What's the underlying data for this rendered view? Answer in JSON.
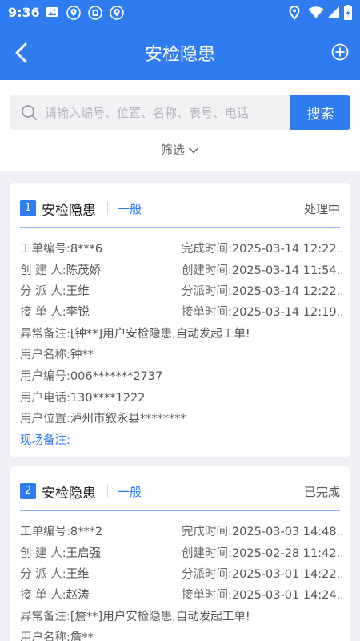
{
  "statusbar": {
    "time": "9:36"
  },
  "header": {
    "title": "安检隐患"
  },
  "search": {
    "placeholder": "请输入编号、位置、名称、表号、电话",
    "button": "搜索"
  },
  "filter": {
    "label": "筛选"
  },
  "cards": [
    {
      "index": "1",
      "title": "安检隐患",
      "level": "一般",
      "status": "处理中",
      "order_no_label": "工单编号:",
      "order_no": "8***6",
      "done_time_label": "完成时间:",
      "done_time": "2025-03-14 12:22...",
      "creator_label": "创 建 人:",
      "creator": "陈茂娇",
      "create_time_label": "创建时间:",
      "create_time": "2025-03-14 11:54...",
      "dispatcher_label": "分 派 人:",
      "dispatcher": "王维",
      "dispatch_time_label": "分派时间:",
      "dispatch_time": "2025-03-14 12:22...",
      "receiver_label": "接 单 人:",
      "receiver": "李锐",
      "receive_time_label": "接单时间:",
      "receive_time": "2025-03-14 12:19...",
      "remark_label": "异常备注:",
      "remark": "[钟**]用户安检隐患,自动发起工单!",
      "user_name_label": "用户名称:",
      "user_name": "钟**",
      "user_no_label": "用户编号:",
      "user_no": "006*******2737",
      "user_phone_label": "用户电话:",
      "user_phone": "130****1222",
      "user_location_label": "用户位置:",
      "user_location": "泸州市叙永县********",
      "site_remark_label": "现场备注:"
    },
    {
      "index": "2",
      "title": "安检隐患",
      "level": "一般",
      "status": "已完成",
      "order_no_label": "工单编号:",
      "order_no": "8***2",
      "done_time_label": "完成时间:",
      "done_time": "2025-03-03 14:48...",
      "creator_label": "创 建 人:",
      "creator": "王启强",
      "create_time_label": "创建时间:",
      "create_time": "2025-02-28 11:42...",
      "dispatcher_label": "分 派 人:",
      "dispatcher": "王维",
      "dispatch_time_label": "分派时间:",
      "dispatch_time": "2025-03-01 14:22...",
      "receiver_label": "接 单 人:",
      "receiver": "赵涛",
      "receive_time_label": "接单时间:",
      "receive_time": "2025-03-01 14:24...",
      "remark_label": "异常备注:",
      "remark": "[詹**]用户安检隐患,自动发起工单!",
      "user_name_label": "用户名称:",
      "user_name": "詹**"
    }
  ],
  "colors": {
    "primary": "#2f7bf0",
    "background": "#eef0f3"
  },
  "icons": [
    "image-icon",
    "location-pin-icon",
    "sim-icon",
    "location-pin-icon",
    "wifi-icon",
    "signal-icon",
    "battery-icon",
    "back-arrow-icon",
    "add-circle-icon",
    "search-icon",
    "chevron-down-icon"
  ]
}
